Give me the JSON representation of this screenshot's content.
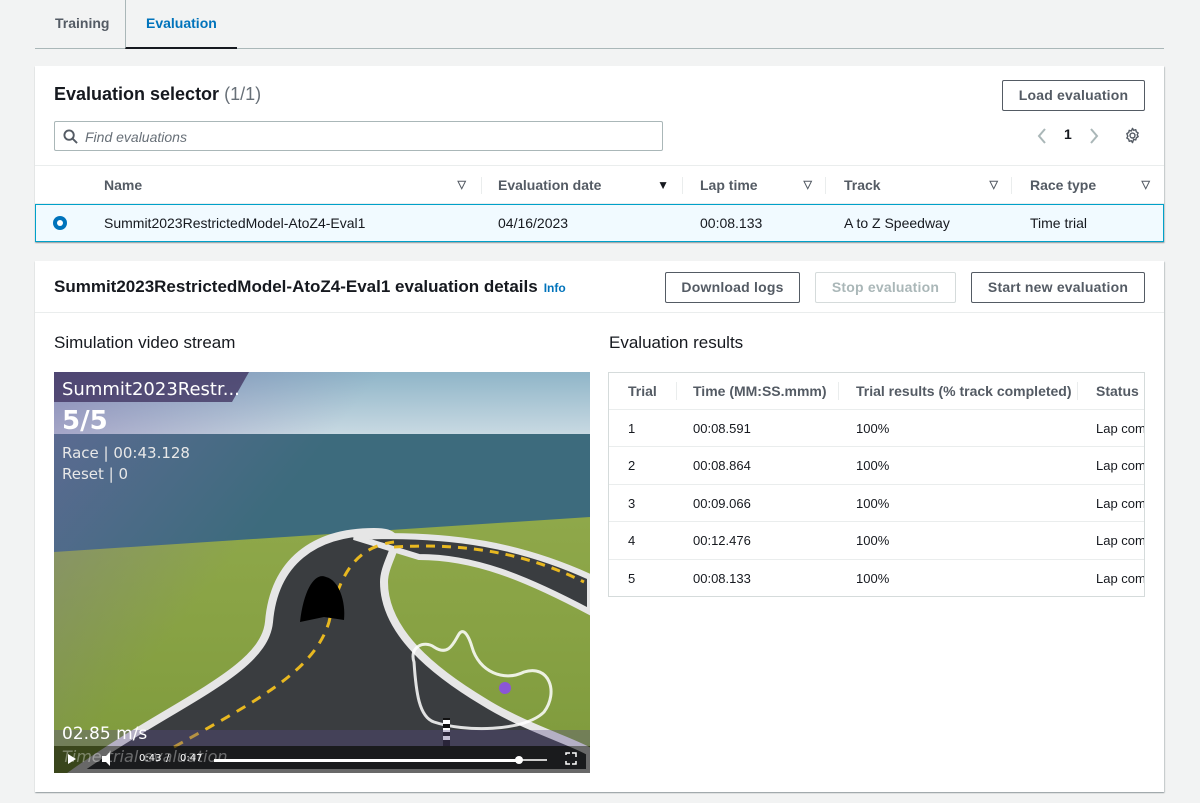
{
  "tabs": [
    {
      "label": "Training"
    },
    {
      "label": "Evaluation"
    }
  ],
  "selector": {
    "title": "Evaluation selector",
    "count": "(1/1)",
    "load_button": "Load evaluation",
    "search_placeholder": "Find evaluations",
    "page": "1",
    "columns": [
      "Name",
      "Evaluation date",
      "Lap time",
      "Track",
      "Race type"
    ],
    "row": {
      "name": "Summit2023RestrictedModel-AtoZ4-Eval1",
      "date": "04/16/2023",
      "lap_time": "00:08.133",
      "track": "A to Z Speedway",
      "race_type": "Time trial"
    }
  },
  "details": {
    "title": "Summit2023RestrictedModel-AtoZ4-Eval1 evaluation details",
    "info": "Info",
    "download_button": "Download logs",
    "stop_button": "Stop evaluation",
    "start_button": "Start new evaluation",
    "video_title": "Simulation video stream",
    "results_title": "Evaluation results"
  },
  "video": {
    "model": "Summit2023Restr...",
    "lap": "5/5",
    "race": "Race | 00:43.128",
    "reset": "Reset | 0",
    "speed": "02.85 m/s",
    "mode": "Time trial evaluation",
    "current_time": "0:43",
    "time_sep": "/",
    "duration": "0:47",
    "progress": 0.91
  },
  "results": {
    "columns": [
      "Trial",
      "Time (MM:SS.mmm)",
      "Trial results (% track completed)",
      "Status"
    ],
    "rows": [
      {
        "trial": "1",
        "time": "00:08.591",
        "pct": "100%",
        "status": "Lap complete"
      },
      {
        "trial": "2",
        "time": "00:08.864",
        "pct": "100%",
        "status": "Lap complete"
      },
      {
        "trial": "3",
        "time": "00:09.066",
        "pct": "100%",
        "status": "Lap complete"
      },
      {
        "trial": "4",
        "time": "00:12.476",
        "pct": "100%",
        "status": "Lap complete"
      },
      {
        "trial": "5",
        "time": "00:08.133",
        "pct": "100%",
        "status": "Lap complete"
      }
    ]
  },
  "colors": {
    "accent": "#0073bb",
    "selected_row": "#f1faff",
    "selected_border": "#00a1c9"
  }
}
